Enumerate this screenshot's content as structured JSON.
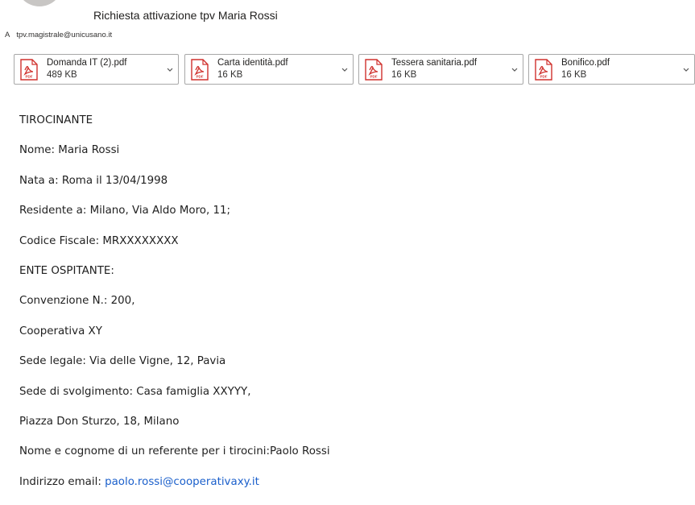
{
  "header": {
    "subject": "Richiesta attivazione tpv Maria Rossi",
    "to_label": "A",
    "to_address": "tpv.magistrale@unicusano.it"
  },
  "attachments": [
    {
      "name": "Domanda IT (2).pdf",
      "size": "489 KB",
      "icon": "pdf-icon"
    },
    {
      "name": "Carta identità.pdf",
      "size": "16 KB",
      "icon": "pdf-icon"
    },
    {
      "name": "Tessera sanitaria.pdf",
      "size": "16 KB",
      "icon": "pdf-icon"
    },
    {
      "name": "Bonifico.pdf",
      "size": "16 KB",
      "icon": "pdf-icon"
    }
  ],
  "body": {
    "lines": [
      "TIROCINANTE",
      "Nome: Maria Rossi",
      "Nata a: Roma il 13/04/1998",
      "Residente a: Milano,  Via Aldo Moro, 11;",
      "Codice Fiscale: MRXXXXXXXX",
      "ENTE OSPITANTE:",
      "Convenzione N.: 200,",
      "Cooperativa XY",
      "Sede legale: Via delle Vigne, 12, Pavia",
      "Sede di svolgimento:  Casa famiglia XXYYY,",
      "Piazza Don Sturzo, 18, Milano",
      "Nome e cognome di un referente per i tirocini:Paolo Rossi"
    ],
    "email_label": "Indirizzo email: ",
    "email_link": "paolo.rossi@cooperativaxy.it"
  },
  "colors": {
    "pdf_red": "#d0312d",
    "link_blue": "#1a5fcb"
  }
}
